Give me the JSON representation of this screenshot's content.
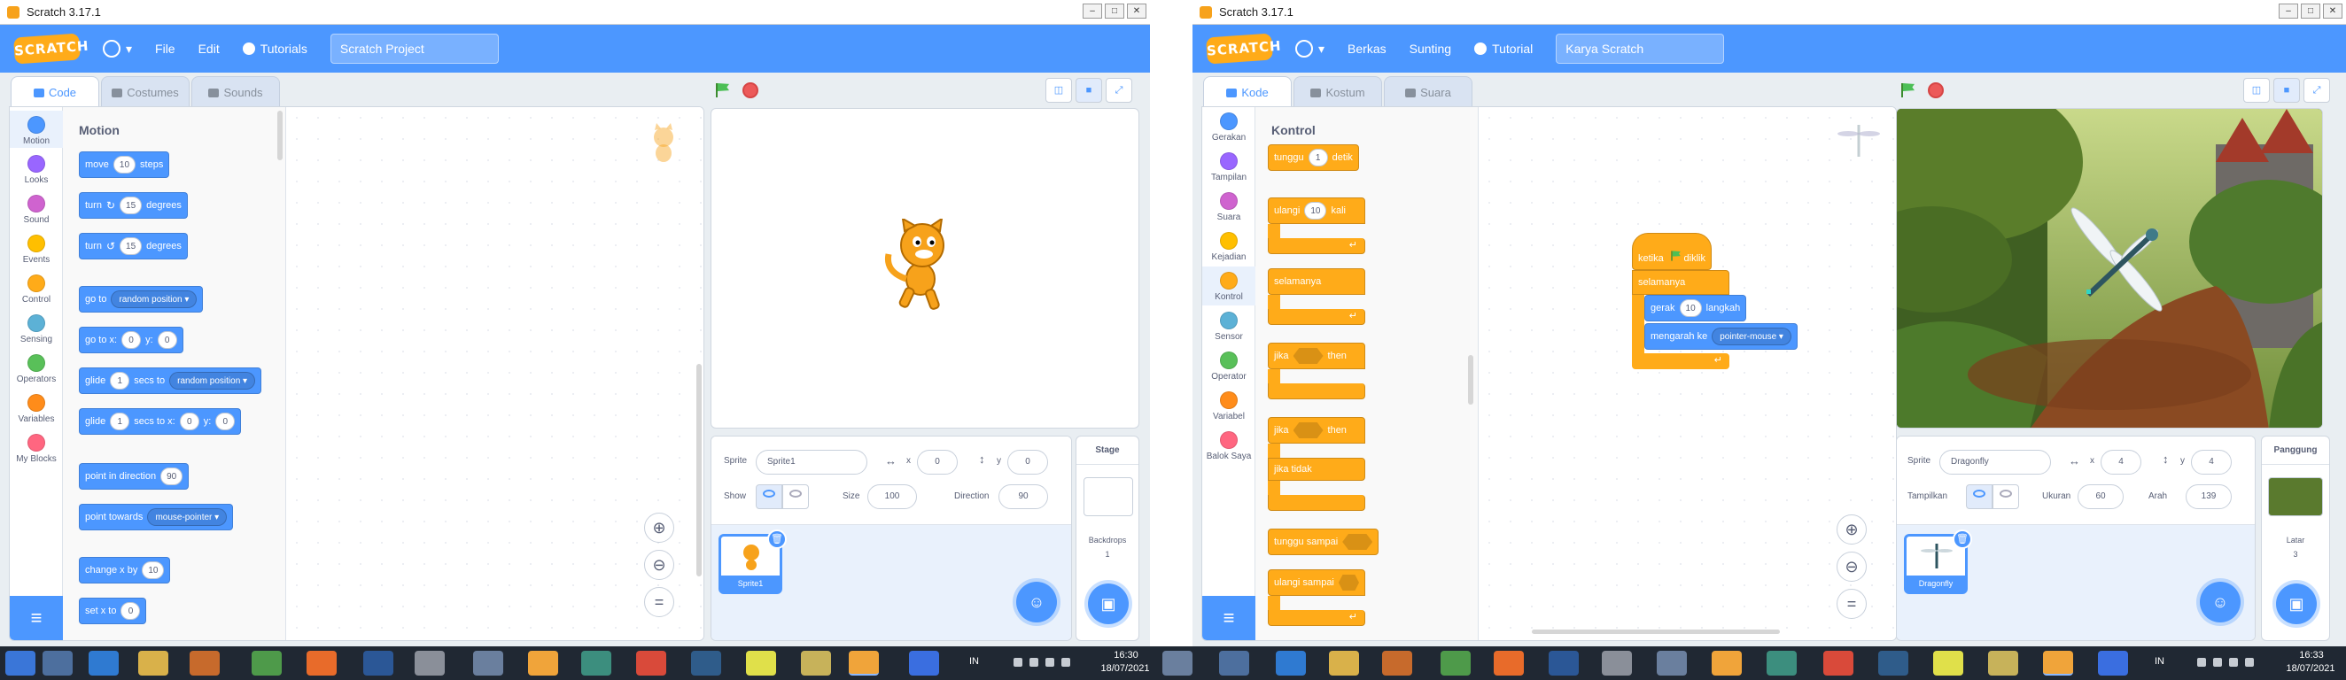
{
  "left": {
    "window_title": "Scratch 3.17.1",
    "menu": {
      "logo": "SCRATCH",
      "file": "File",
      "edit": "Edit",
      "tutorials": "Tutorials",
      "project_title": "Scratch Project"
    },
    "tabs": [
      "Code",
      "Costumes",
      "Sounds"
    ],
    "categories": [
      "Motion",
      "Looks",
      "Sound",
      "Events",
      "Control",
      "Sensing",
      "Operators",
      "Variables",
      "My Blocks"
    ],
    "palette_heading": "Motion",
    "blocks": {
      "move": {
        "a": "move",
        "v": "10",
        "b": "steps"
      },
      "turn_cw": {
        "a": "turn",
        "v": "15",
        "b": "degrees"
      },
      "turn_ccw": {
        "a": "turn",
        "v": "15",
        "b": "degrees"
      },
      "goto": {
        "a": "go to",
        "dd": "random position"
      },
      "goto_xy": {
        "a": "go to x:",
        "x": "0",
        "y_lbl": "y:",
        "y": "0"
      },
      "glide_to": {
        "a": "glide",
        "v": "1",
        "b": "secs to",
        "dd": "random position"
      },
      "glide_xy": {
        "a": "glide",
        "v": "1",
        "b": "secs to x:",
        "x": "0",
        "y_lbl": "y:",
        "y": "0"
      },
      "point_dir": {
        "a": "point in direction",
        "v": "90"
      },
      "point_towards": {
        "a": "point towards",
        "dd": "mouse-pointer"
      },
      "change_x": {
        "a": "change x by",
        "v": "10"
      },
      "set_x": {
        "a": "set x to",
        "v": "0"
      }
    },
    "sprite_info": {
      "sprite_lbl": "Sprite",
      "sprite": "Sprite1",
      "x_lbl": "x",
      "x": "0",
      "y_lbl": "y",
      "y": "0",
      "show_lbl": "Show",
      "size_lbl": "Size",
      "size": "100",
      "dir_lbl": "Direction",
      "dir": "90"
    },
    "sprite_thumb": "Sprite1",
    "stage_pane": {
      "title": "Stage",
      "backdrops_lbl": "Backdrops",
      "backdrops": "1"
    }
  },
  "right": {
    "window_title": "Scratch 3.17.1",
    "menu": {
      "logo": "SCRATCH",
      "file": "Berkas",
      "edit": "Sunting",
      "tutorials": "Tutorial",
      "project_title": "Karya Scratch"
    },
    "tabs": [
      "Kode",
      "Kostum",
      "Suara"
    ],
    "categories": [
      "Gerakan",
      "Tampilan",
      "Suara",
      "Kejadian",
      "Kontrol",
      "Sensor",
      "Operator",
      "Variabel",
      "Balok Saya"
    ],
    "palette_heading": "Kontrol",
    "blocks": {
      "wait": {
        "a": "tunggu",
        "v": "1",
        "b": "detik"
      },
      "repeat": {
        "a": "ulangi",
        "v": "10",
        "b": "kali"
      },
      "forever": {
        "a": "selamanya"
      },
      "if": {
        "a": "jika",
        "b": "then"
      },
      "ifelse": {
        "a": "jika",
        "b": "then",
        "c": "jika tidak"
      },
      "wait_until": {
        "a": "tunggu sampai"
      },
      "repeat_until": {
        "a": "ulangi sampai"
      }
    },
    "script": {
      "hat": "ketika",
      "hat_b": "diklik",
      "forever": "selamanya",
      "move_a": "gerak",
      "move_v": "10",
      "move_b": "langkah",
      "point_a": "mengarah ke",
      "point_dd": "pointer-mouse"
    },
    "sprite_info": {
      "sprite_lbl": "Sprite",
      "sprite": "Dragonfly",
      "x_lbl": "x",
      "x": "4",
      "y_lbl": "y",
      "y": "4",
      "show_lbl": "Tampilkan",
      "size_lbl": "Ukuran",
      "size": "60",
      "dir_lbl": "Arah",
      "dir": "139"
    },
    "sprite_thumb": "Dragonfly",
    "stage_pane": {
      "title": "Panggung",
      "backdrops_lbl": "Latar",
      "backdrops": "3"
    }
  },
  "taskbar": {
    "left": {
      "lang": "IN",
      "time": "16:30",
      "date": "18/07/2021"
    },
    "right": {
      "lang": "IN",
      "time": "16:33",
      "date": "18/07/2021"
    }
  },
  "colors": {
    "motion": "#4c97ff",
    "looks": "#9966ff",
    "sound": "#cf63cf",
    "events": "#ffbf00",
    "control": "#ffab19",
    "sensing": "#5cb1d6",
    "operators": "#59c059",
    "variables": "#ff8c1a",
    "myblocks": "#ff6680"
  }
}
